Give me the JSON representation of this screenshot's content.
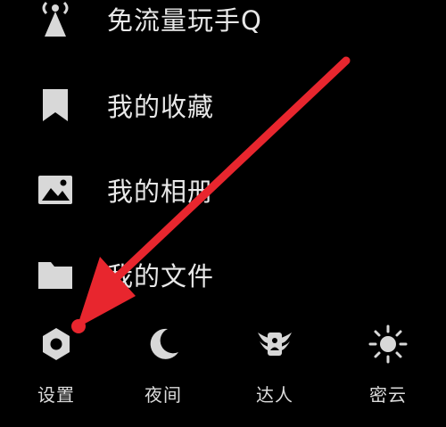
{
  "menu": {
    "items": [
      {
        "label": "免流量玩手Q",
        "icon": "signal-tower-icon"
      },
      {
        "label": "我的收藏",
        "icon": "bookmark-icon"
      },
      {
        "label": "我的相册",
        "icon": "photo-icon"
      },
      {
        "label": "我的文件",
        "icon": "folder-icon"
      }
    ]
  },
  "bottom_bar": {
    "items": [
      {
        "label": "设置",
        "icon": "settings-hexagon-icon"
      },
      {
        "label": "夜间",
        "icon": "moon-icon"
      },
      {
        "label": "达人",
        "icon": "badge-wings-icon"
      },
      {
        "label": "密云",
        "icon": "sun-icon"
      }
    ]
  },
  "colors": {
    "background": "#000000",
    "text": "#e8e8e8",
    "icon": "#d8d8d8",
    "annotation_arrow": "#e8262e"
  }
}
